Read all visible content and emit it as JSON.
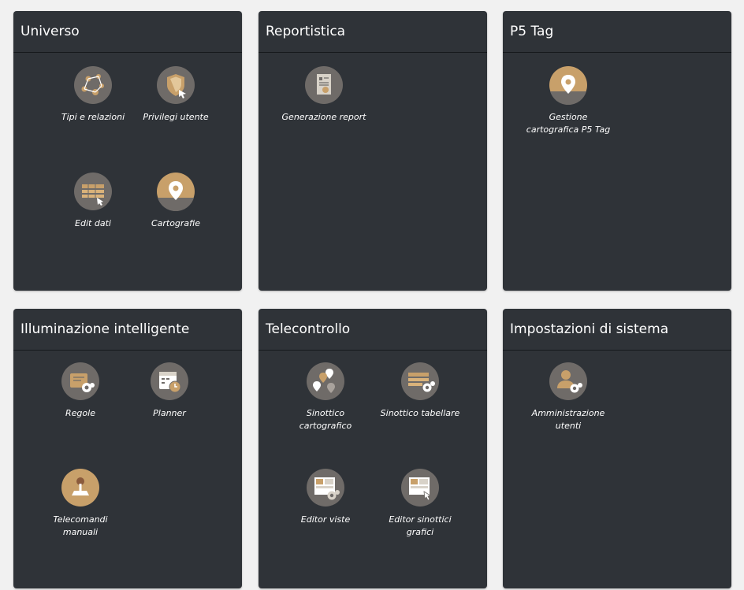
{
  "colors": {
    "background": "#f1f1f1",
    "panel": "#2f3338",
    "icon_circle": "#6f6b68",
    "icon_accent": "#c8a06a",
    "text": "#ffffff"
  },
  "panels": [
    {
      "title": "Universo",
      "items": [
        {
          "label": "Tipi e relazioni",
          "icon": "network-icon"
        },
        {
          "label": "Privilegi utente",
          "icon": "shield-pointer-icon"
        },
        {
          "label": "Edit dati",
          "icon": "table-edit-icon"
        },
        {
          "label": "Cartografie",
          "icon": "map-pin-icon"
        }
      ]
    },
    {
      "title": "Reportistica",
      "items": [
        {
          "label": "Generazione report",
          "icon": "report-icon"
        }
      ]
    },
    {
      "title": "P5 Tag",
      "items": [
        {
          "label": "Gestione\ncartografica P5 Tag",
          "icon": "map-pin-icon"
        }
      ]
    },
    {
      "title": "Illuminazione intelligente",
      "items": [
        {
          "label": "Regole",
          "icon": "rules-gear-icon"
        },
        {
          "label": "Planner",
          "icon": "calendar-clock-icon"
        },
        {
          "label": "Telecomandi\nmanuali",
          "icon": "joystick-icon"
        }
      ]
    },
    {
      "title": "Telecontrollo",
      "items": [
        {
          "label": "Sinottico\ncartografico",
          "icon": "multi-pin-icon"
        },
        {
          "label": "Sinottico tabellare",
          "icon": "table-gear-icon"
        },
        {
          "label": "Editor viste",
          "icon": "layout-gear-icon"
        },
        {
          "label": "Editor sinottici\ngrafici",
          "icon": "layout-edit-icon"
        }
      ]
    },
    {
      "title": "Impostazioni di sistema",
      "items": [
        {
          "label": "Amministrazione\nutenti",
          "icon": "users-gear-icon"
        }
      ]
    }
  ]
}
